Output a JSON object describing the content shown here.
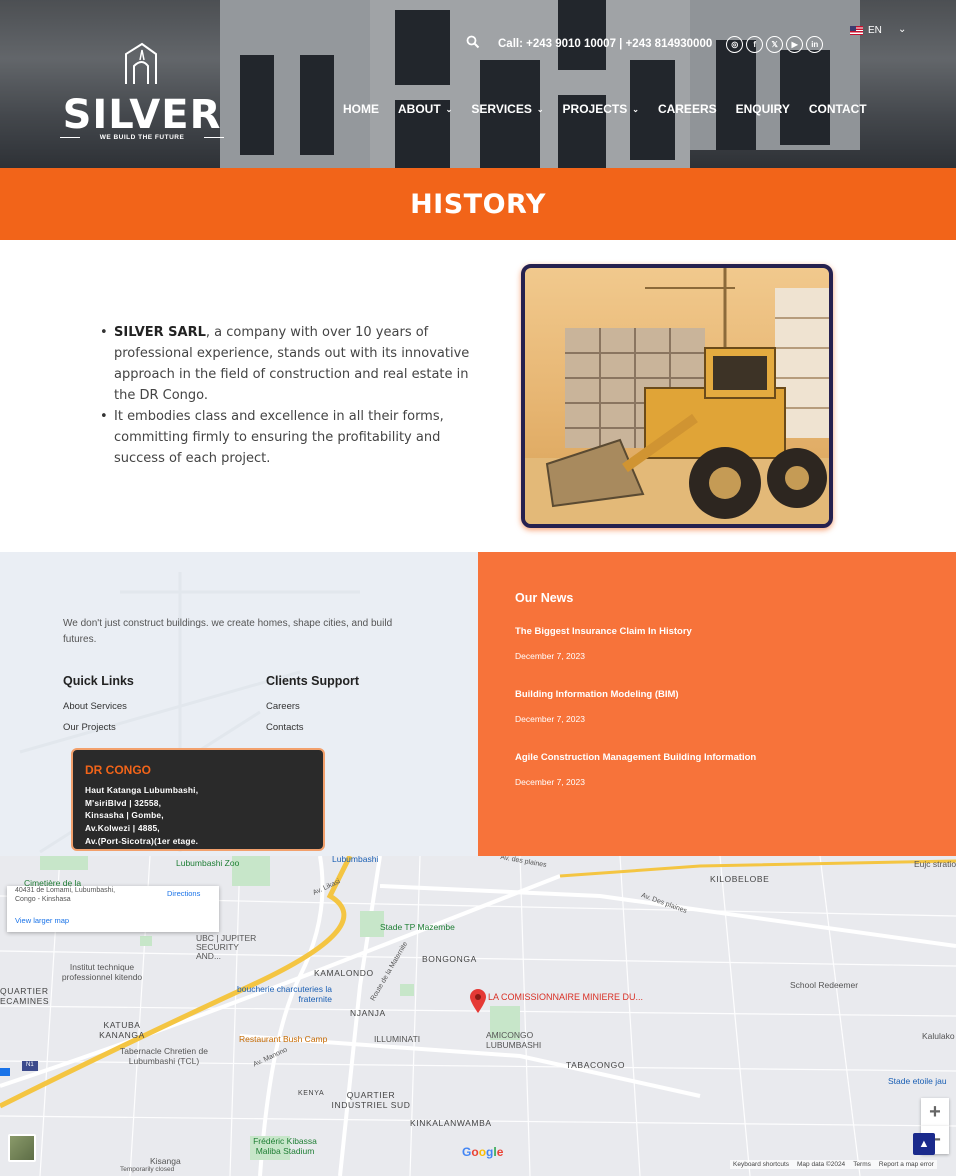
{
  "header": {
    "logo_text": "SILVER",
    "logo_tagline": "WE BUILD THE FUTURE",
    "call_text": "Call: +243 9010 10007 | +243 814930000",
    "social_icons": [
      "instagram-icon",
      "facebook-icon",
      "x-twitter-icon",
      "youtube-icon",
      "linkedin-icon"
    ],
    "language": "EN",
    "nav": [
      {
        "label": "HOME",
        "has_dropdown": false
      },
      {
        "label": "ABOUT",
        "has_dropdown": true
      },
      {
        "label": "SERVICES",
        "has_dropdown": true
      },
      {
        "label": "PROJECTS",
        "has_dropdown": true
      },
      {
        "label": "CAREERS",
        "has_dropdown": false
      },
      {
        "label": "ENQUIRY",
        "has_dropdown": false
      },
      {
        "label": "CONTACT",
        "has_dropdown": false
      }
    ]
  },
  "banner": {
    "title": "HISTORY"
  },
  "history": {
    "bullet1_bold": "SILVER SARL",
    "bullet1_rest": ", a company with over 10 years of professional experience, stands out with its innovative approach in the field of construction and real estate in the DR Congo.",
    "bullet2": "It embodies class and excellence in all their forms, committing firmly to ensuring the profitability and success of each project."
  },
  "footer": {
    "tagline": "We don't just construct buildings. we create homes, shape cities, and build futures.",
    "quick_links": {
      "heading": "Quick Links",
      "items": [
        "About Services",
        "Our Projects"
      ]
    },
    "clients_support": {
      "heading": "Clients Support",
      "items": [
        "Careers",
        "Contacts"
      ]
    },
    "address": {
      "title": "DR CONGO",
      "lines": [
        "Haut Katanga Lubumbashi,",
        "M'siriBlvd | 32558,",
        "Kinsasha | Gombe,",
        "Av.Kolwezi | 4885,",
        "Av.(Port-Sicotra)(1er etage."
      ]
    },
    "news": {
      "heading": "Our News",
      "items": [
        {
          "title": "The Biggest Insurance Claim In History",
          "date": "December 7, 2023"
        },
        {
          "title": "Building Information Modeling (BIM)",
          "date": "December 7, 2023"
        },
        {
          "title": "Agile Construction Management Building Information",
          "date": "December 7, 2023"
        }
      ]
    }
  },
  "map": {
    "card_address": "Congo - Kinshasa",
    "card_partial": "40431 de Lomami, Lubumbashi,",
    "directions": "Directions",
    "larger_map": "View larger map",
    "marker": "LA COMISSIONNAIRE MINIERE DU...",
    "labels": {
      "zoo": "Lubumbashi Zoo",
      "cimetiere": "Cimetière de la",
      "lubumbashi_road": "Lubumbashi",
      "av_des_plaines": "Av. des plaines",
      "av_des_plaines2": "Av. Des plaines",
      "kilobelobe": "KILOBELOBE",
      "eujc": "Eujc stratio",
      "av_likasi": "Av. Likasi",
      "stade": "Stade TP Mazembe",
      "ubc": "UBC | JUPITER SECURITY AND...",
      "bongonga": "BONGONGA",
      "institut": "Institut technique professionnel kitendo",
      "kamalondo": "KAMALONDO",
      "route": "Route de la Maternite",
      "quartier": "QUARTIER ECAMINES",
      "boucherie": "boucherie charcuteries la fraternite",
      "school": "School Redeemer",
      "katuba": "KATUBA KANANGA",
      "njanja": "NJANJA",
      "kalulako": "Kalulako",
      "restaurant": "Restaurant Bush Camp",
      "illuminati": "ILLUMINATI",
      "amicongo": "AMICONGO LUBUMBASHI",
      "tabernacle": "Tabernacle Chretien de Lubumbashi (TCL)",
      "tabacongo": "TABACONGO",
      "av_manono": "Av. Manono",
      "n1": "N1",
      "kenya": "KENYA",
      "quartier_indus": "QUARTIER INDUSTRIEL SUD",
      "stade_etoile": "Stade etoile jau",
      "kinkalanwamba": "KINKALANWAMBA",
      "frederic": "Frédéric Kibassa Maliba Stadium",
      "kisanga": "Kisanga",
      "temporarily": "Temporarily closed"
    },
    "footer_links": [
      "Keyboard shortcuts",
      "Map data ©2024",
      "Terms",
      "Report a map error"
    ],
    "google": "Google",
    "zoom_in": "+",
    "zoom_out": "−"
  }
}
